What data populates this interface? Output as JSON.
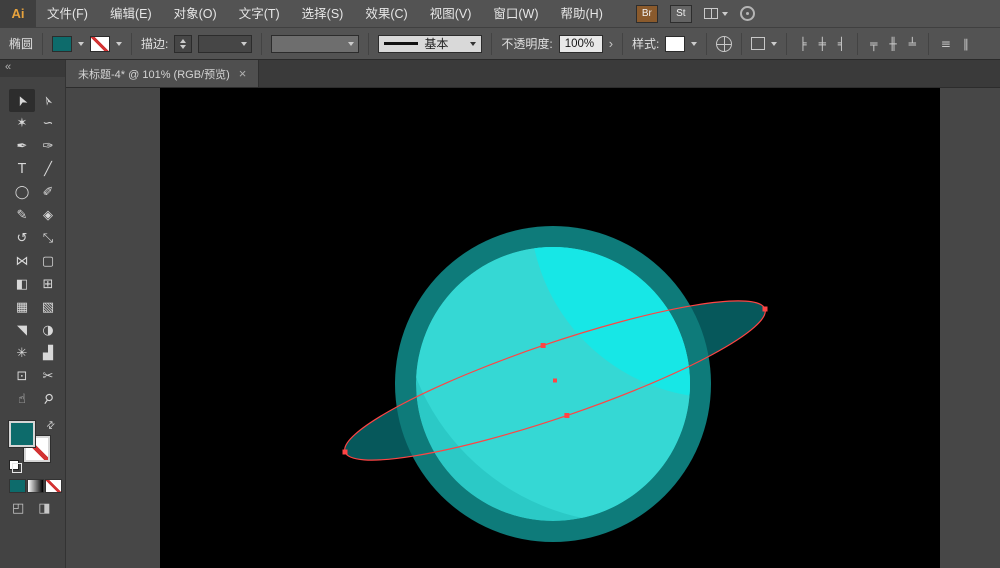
{
  "colors": {
    "br_tile": "#8a5a2c",
    "fill_teal": "#0d6b6b"
  },
  "menubar": {
    "logo": "Ai",
    "items": [
      "文件(F)",
      "编辑(E)",
      "对象(O)",
      "文字(T)",
      "选择(S)",
      "效果(C)",
      "视图(V)",
      "窗口(W)",
      "帮助(H)"
    ],
    "bridge_label": "Br",
    "stock_label": "St"
  },
  "controlbar": {
    "context_label": "椭圆",
    "stroke_label": "描边:",
    "profile_value": "基本",
    "opacity_label": "不透明度:",
    "opacity_value": "100%",
    "opacity_chevron": "›",
    "style_label": "样式:",
    "align_icons": [
      "╞",
      "╪",
      "╡",
      "╤",
      "╫",
      "╧",
      "≡",
      "∥"
    ]
  },
  "tabbar": {
    "title": "未标题-4* @ 101% (RGB/预览)",
    "close": "×"
  },
  "toolbar": {
    "collapse": "«",
    "swap_glyph": "⇄",
    "draw_mode_glyph": "◰",
    "screen_mode_glyph": "◨",
    "tools": [
      {
        "name": "selection",
        "glyph": "➤"
      },
      {
        "name": "direct-selection",
        "glyph": "➢"
      },
      {
        "name": "magic-wand",
        "glyph": "✶"
      },
      {
        "name": "lasso",
        "glyph": "∽"
      },
      {
        "name": "pen",
        "glyph": "✒"
      },
      {
        "name": "curvature",
        "glyph": "✑"
      },
      {
        "name": "type",
        "glyph": "T"
      },
      {
        "name": "line-segment",
        "glyph": "╱"
      },
      {
        "name": "ellipse",
        "glyph": "◯"
      },
      {
        "name": "paintbrush",
        "glyph": "✐"
      },
      {
        "name": "pencil",
        "glyph": "✎"
      },
      {
        "name": "eraser",
        "glyph": "◈"
      },
      {
        "name": "rotate",
        "glyph": "↺"
      },
      {
        "name": "scale",
        "glyph": "⤡"
      },
      {
        "name": "width",
        "glyph": "⋈"
      },
      {
        "name": "free-transform",
        "glyph": "▢"
      },
      {
        "name": "shape-builder",
        "glyph": "◧"
      },
      {
        "name": "perspective-grid",
        "glyph": "⊞"
      },
      {
        "name": "mesh",
        "glyph": "▦"
      },
      {
        "name": "gradient",
        "glyph": "▧"
      },
      {
        "name": "eyedropper",
        "glyph": "◥"
      },
      {
        "name": "blend",
        "glyph": "◑"
      },
      {
        "name": "symbol-sprayer",
        "glyph": "✳"
      },
      {
        "name": "column-graph",
        "glyph": "▟"
      },
      {
        "name": "artboard",
        "glyph": "⊡"
      },
      {
        "name": "slice",
        "glyph": "✂"
      },
      {
        "name": "hand",
        "glyph": "☝"
      },
      {
        "name": "zoom",
        "glyph": "⚲"
      }
    ]
  },
  "canvas": {
    "colors": {
      "ring": "#06585b",
      "outer": "#0e7b7a",
      "base": "#2bc9c6",
      "mid": "#35d8d4",
      "highlight": "#17e7e6",
      "selection": "#ff4444"
    }
  }
}
